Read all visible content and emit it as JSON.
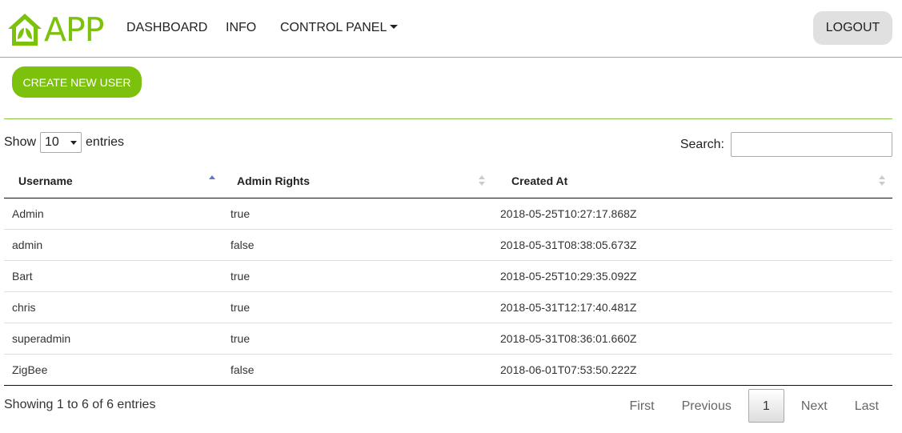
{
  "brand": {
    "text": "APP",
    "color": "#7cc10c"
  },
  "nav": {
    "dashboard": "DASHBOARD",
    "info": "INFO",
    "control_panel": "CONTROL PANEL",
    "logout": "LOGOUT"
  },
  "actions": {
    "create_user": "CREATE NEW USER"
  },
  "table_controls": {
    "show_label": "Show",
    "entries_label": "entries",
    "page_length": "10",
    "search_label": "Search:",
    "search_value": ""
  },
  "table": {
    "columns": [
      "Username",
      "Admin Rights",
      "Created At"
    ],
    "sorted_column": "Username",
    "sort_direction": "ascending",
    "rows": [
      [
        "Admin",
        "true",
        "2018-05-25T10:27:17.868Z"
      ],
      [
        "admin",
        "false",
        "2018-05-31T08:38:05.673Z"
      ],
      [
        "Bart",
        "true",
        "2018-05-25T10:29:35.092Z"
      ],
      [
        "chris",
        "true",
        "2018-05-31T12:17:40.481Z"
      ],
      [
        "superadmin",
        "true",
        "2018-05-31T08:36:01.660Z"
      ],
      [
        "ZigBee",
        "false",
        "2018-06-01T07:53:50.222Z"
      ]
    ]
  },
  "footer": {
    "info": "Showing 1 to 6 of 6 entries",
    "first": "First",
    "previous": "Previous",
    "current_page": "1",
    "next": "Next",
    "last": "Last"
  },
  "icons": {
    "logo": "house-leaf-icon",
    "dropdown": "caret-down-icon",
    "sort": "sort-arrows-icon"
  }
}
